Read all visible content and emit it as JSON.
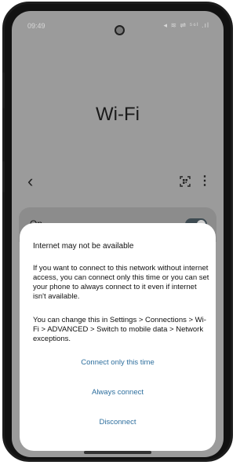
{
  "status_bar": {
    "time": "09:49",
    "icons": "◂ ≋ ⇌ ⁵⁶ᴵ .ıl"
  },
  "page": {
    "title": "Wi-Fi"
  },
  "toolbar": {
    "back_icon": "‹",
    "qr_icon": "qr-scan",
    "more_icon": "⋮"
  },
  "wifi_toggle": {
    "label": "On",
    "enabled": true
  },
  "dialog": {
    "title": "Internet may not be available",
    "message": "If you want to connect to this network without internet access, you can connect only this time or you can set your phone to always connect to it even if internet isn't available.",
    "hint": "You can change this in Settings > Connections > Wi-Fi > ADVANCED > Switch to mobile data > Network exceptions.",
    "buttons": {
      "connect_once": "Connect only this time",
      "always_connect": "Always connect",
      "disconnect": "Disconnect"
    }
  },
  "colors": {
    "accent": "#2e6f9e",
    "scrim": "#9b9b9b",
    "toggle_on": "#3e4b52"
  }
}
